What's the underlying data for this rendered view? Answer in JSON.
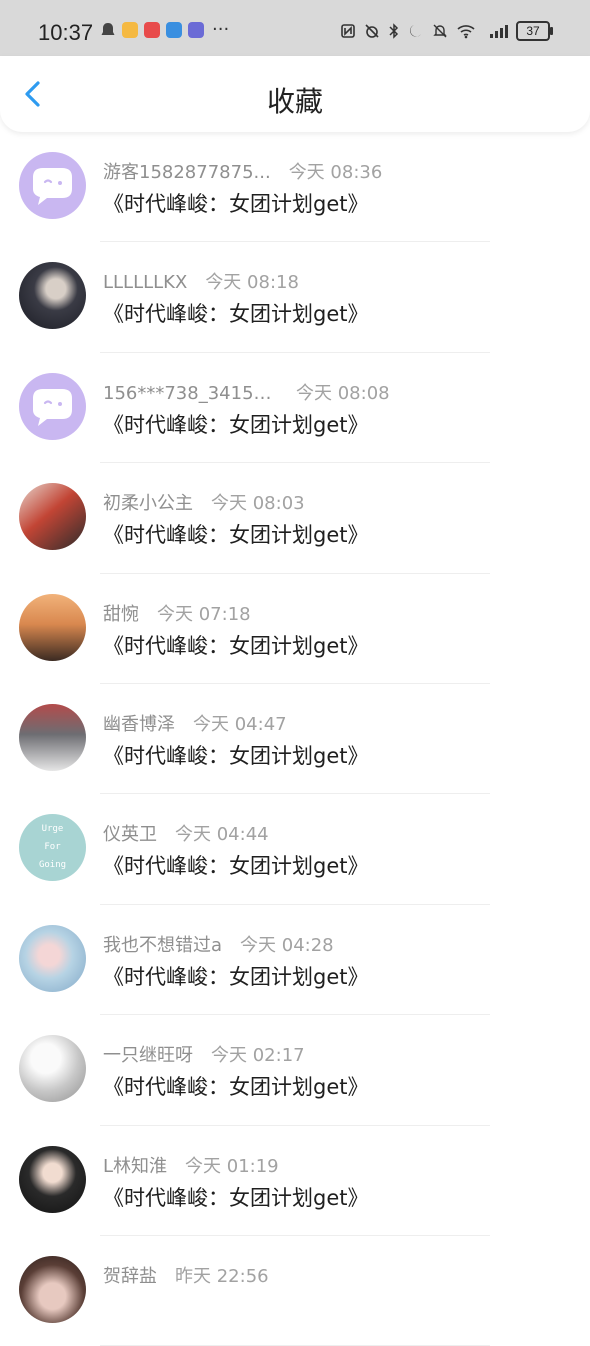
{
  "status_bar": {
    "time": "10:37",
    "ellipsis": "···",
    "battery": "37",
    "icons_left": [
      "ghost-icon",
      "app-icon-yellow",
      "app-icon-red",
      "app-icon-blue",
      "app-icon-purple"
    ],
    "icons_right": [
      "nfc-icon",
      "alarm-off-icon",
      "bluetooth-icon",
      "moon-icon",
      "bell-off-icon",
      "wifi-icon",
      "signal-4g-icon",
      "battery-icon"
    ]
  },
  "header": {
    "title": "收藏",
    "back_icon": "chevron-left-icon",
    "accent": "#2e9bf0"
  },
  "items": [
    {
      "name": "游客1582877875...",
      "time": "今天 08:36",
      "title": "《时代峰峻：女团计划get》",
      "avatar": "default-chat-avatar"
    },
    {
      "name": "LLLLLLKX",
      "time": "今天 08:18",
      "title": "《时代峰峻：女团计划get》",
      "avatar": "photo-avatar"
    },
    {
      "name": "156***738_34154...",
      "time": "今天 08:08",
      "title": "《时代峰峻：女团计划get》",
      "avatar": "default-chat-avatar"
    },
    {
      "name": "初柔小公主",
      "time": "今天 08:03",
      "title": "《时代峰峻：女团计划get》",
      "avatar": "photo-avatar"
    },
    {
      "name": "甜惋",
      "time": "今天 07:18",
      "title": "《时代峰峻：女团计划get》",
      "avatar": "photo-avatar"
    },
    {
      "name": "幽香博泽",
      "time": "今天 04:47",
      "title": "《时代峰峻：女团计划get》",
      "avatar": "photo-avatar"
    },
    {
      "name": "仪英卫",
      "time": "今天 04:44",
      "title": "《时代峰峻：女团计划get》",
      "avatar": "text-avatar",
      "avatar_text": [
        "Urge",
        "For",
        "Going"
      ]
    },
    {
      "name": "我也不想错过a",
      "time": "今天 04:28",
      "title": "《时代峰峻：女团计划get》",
      "avatar": "photo-avatar"
    },
    {
      "name": "一只继旺呀",
      "time": "今天 02:17",
      "title": "《时代峰峻：女团计划get》",
      "avatar": "photo-avatar"
    },
    {
      "name": "L林知淮",
      "time": "今天 01:19",
      "title": "《时代峰峻：女团计划get》",
      "avatar": "photo-avatar"
    },
    {
      "name": "贺辞盐",
      "time": "昨天 22:56",
      "title": "",
      "avatar": "photo-avatar"
    }
  ]
}
